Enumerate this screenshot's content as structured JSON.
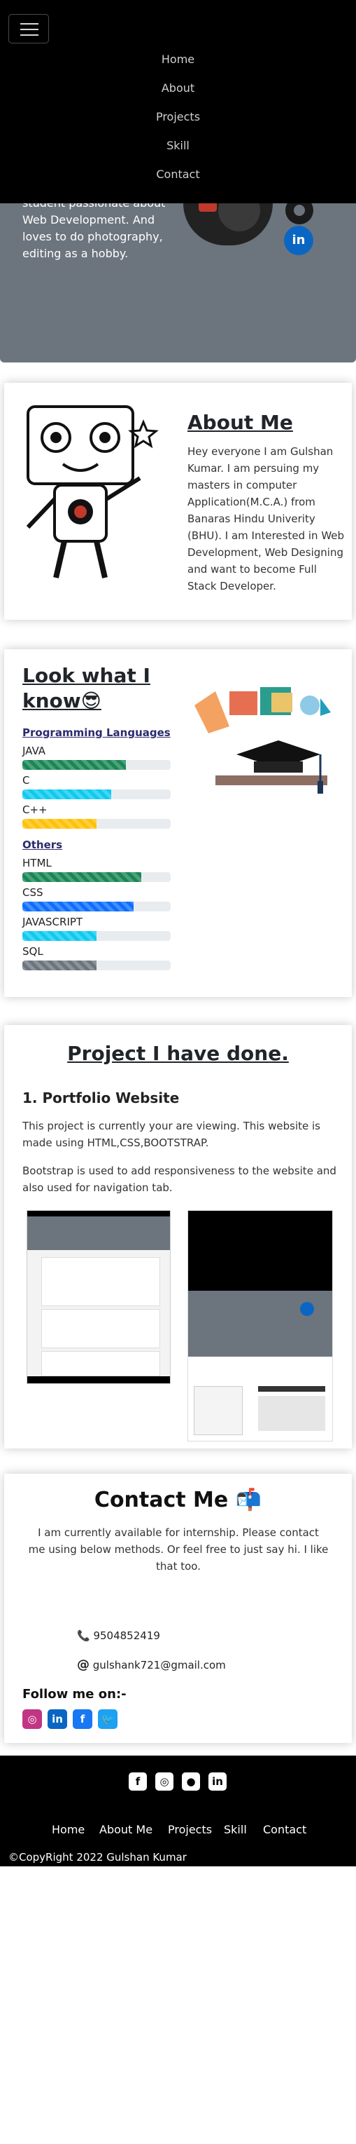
{
  "nav": {
    "toggle_icon": "hamburger-icon",
    "items": [
      "Home",
      "About",
      "Projects",
      "Skill",
      "Contact"
    ]
  },
  "hero": {
    "text": "student passionate about Web Development. And loves to do photography, editing as a hobby.",
    "social_icons": [
      "github-icon",
      "linkedin-icon"
    ],
    "linkedin_glyph": "in"
  },
  "about": {
    "title": "About Me",
    "text": "Hey everyone I am Gulshan Kumar. I am persuing my masters in computer Application(M.C.A.) from Banaras Hindu Univerity (BHU). I am Interested in Web Development, Web Designing and want to become Full Stack Developer."
  },
  "skills": {
    "title": "Look what I know😎",
    "programming_heading": "Programming Languages",
    "others_heading": "Others",
    "programming": [
      {
        "name": "JAVA",
        "level": 0.7,
        "color": "#198754"
      },
      {
        "name": "C",
        "level": 0.6,
        "color": "#0dcaf0"
      },
      {
        "name": "C++",
        "level": 0.5,
        "color": "#ffc107"
      }
    ],
    "others": [
      {
        "name": "HTML",
        "level": 0.8,
        "color": "#198754"
      },
      {
        "name": "CSS",
        "level": 0.75,
        "color": "#0d6efd"
      },
      {
        "name": "JAVASCRIPT",
        "level": 0.5,
        "color": "#0dcaf0"
      },
      {
        "name": "SQL",
        "level": 0.5,
        "color": "#6c757d"
      }
    ]
  },
  "projects": {
    "title": "Project I have done.",
    "name": "1. Portfolio Website",
    "p1": "This project is currently your are viewing. This website is made using HTML,CSS,BOOTSTRAP.",
    "p2": "Bootstrap is used to add responsiveness to the website and also used for navigation tab."
  },
  "contact": {
    "title": "Contact Me 📬",
    "text": "I am currently available for internship. Please contact me using below methods. Or feel free to just say hi. I like that too.",
    "phone_icon": "📞",
    "phone": "9504852419",
    "email_icon": "@",
    "email": "gulshank721@gmail.com",
    "follow": "Follow me on:-",
    "socials": [
      {
        "icon": "instagram-icon",
        "glyph": "◎",
        "color": "#c13584"
      },
      {
        "icon": "linkedin-icon",
        "glyph": "in",
        "color": "#0a66c2"
      },
      {
        "icon": "facebook-icon",
        "glyph": "f",
        "color": "#1877f2"
      },
      {
        "icon": "twitter-icon",
        "glyph": "🐦",
        "color": "#1da1f2"
      }
    ]
  },
  "footer": {
    "icons": [
      {
        "icon": "facebook-icon",
        "glyph": "f"
      },
      {
        "icon": "instagram-icon",
        "glyph": "◎"
      },
      {
        "icon": "github-icon",
        "glyph": "●"
      },
      {
        "icon": "linkedin-icon",
        "glyph": "in"
      }
    ],
    "links": [
      "Home",
      "About Me",
      "Projects",
      "Skill",
      "Contact"
    ],
    "copyright": "©CopyRight 2022 Gulshan Kumar"
  }
}
